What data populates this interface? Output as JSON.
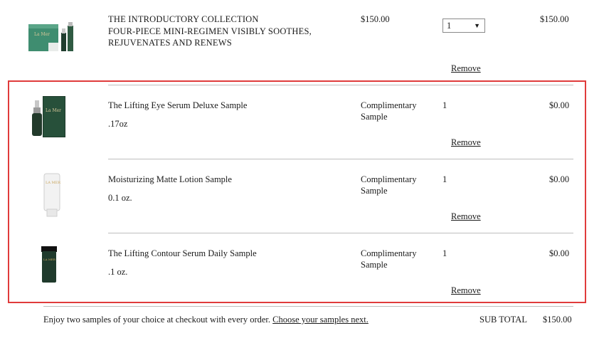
{
  "main_item": {
    "title_lines": [
      "THE INTRODUCTORY COLLECTION",
      "FOUR-PIECE MINI-REGIMEN VISIBLY SOOTHES,",
      "REJUVENATES AND RENEWS"
    ],
    "price": "$150.00",
    "quantity": "1",
    "total": "$150.00",
    "remove_label": "Remove",
    "image_icon": "product-set-icon"
  },
  "samples": [
    {
      "name": "The Lifting Eye Serum Deluxe Sample",
      "size": ".17oz",
      "price_lines": [
        "Complimentary",
        "Sample"
      ],
      "quantity": "1",
      "total": "$0.00",
      "remove_label": "Remove",
      "image_icon": "eye-serum-bottle-icon"
    },
    {
      "name": "Moisturizing Matte Lotion Sample",
      "size": "0.1 oz.",
      "price_lines": [
        "Complimentary",
        "Sample"
      ],
      "quantity": "1",
      "total": "$0.00",
      "remove_label": "Remove",
      "image_icon": "lotion-tube-icon"
    },
    {
      "name": "The Lifting Contour Serum Daily Sample",
      "size": ".1 oz.",
      "price_lines": [
        "Complimentary",
        "Sample"
      ],
      "quantity": "1",
      "total": "$0.00",
      "remove_label": "Remove",
      "image_icon": "serum-tube-icon"
    }
  ],
  "footer": {
    "promo_text": "Enjoy two samples of your choice at checkout with every order.",
    "promo_link": "Choose your samples next.",
    "subtotal_label": "SUB TOTAL",
    "subtotal_value": "$150.00"
  },
  "colors": {
    "highlight": "#e03b3b",
    "box_green": "#3d8a6e",
    "dark_green": "#1f3a2c"
  }
}
